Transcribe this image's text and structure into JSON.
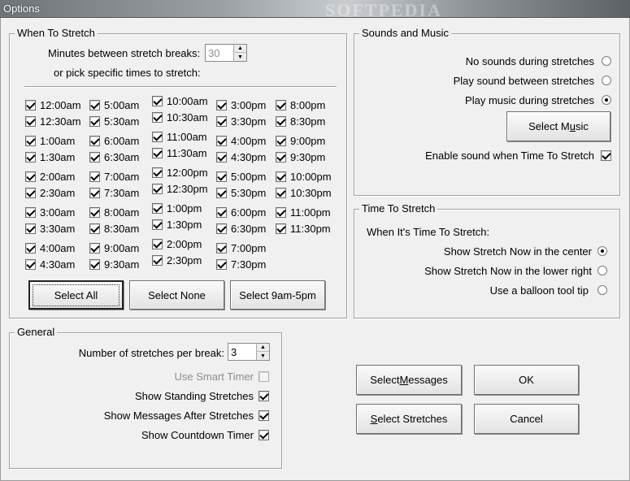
{
  "window": {
    "title": "Options",
    "watermark": "SOFTPEDIA"
  },
  "stretch": {
    "legend": "When To Stretch",
    "minutes_label": "Minutes between stretch breaks:",
    "minutes_value": "30",
    "pick_label": "or pick specific times to stretch:",
    "times": [
      [
        "12:00am",
        "5:00am",
        "10:00am",
        "3:00pm",
        "8:00pm"
      ],
      [
        "12:30am",
        "5:30am",
        "10:30am",
        "3:30pm",
        "8:30pm"
      ],
      [
        "1:00am",
        "6:00am",
        "11:00am",
        "4:00pm",
        "9:00pm"
      ],
      [
        "1:30am",
        "6:30am",
        "11:30am",
        "4:30pm",
        "9:30pm"
      ],
      [
        "2:00am",
        "7:00am",
        "12:00pm",
        "5:00pm",
        "10:00pm"
      ],
      [
        "2:30am",
        "7:30am",
        "12:30pm",
        "5:30pm",
        "10:30pm"
      ],
      [
        "3:00am",
        "8:00am",
        "1:00pm",
        "6:00pm",
        "11:00pm"
      ],
      [
        "3:30am",
        "8:30am",
        "1:30pm",
        "6:30pm",
        "11:30pm"
      ],
      [
        "4:00am",
        "9:00am",
        "2:00pm",
        "7:00pm",
        ""
      ],
      [
        "4:30am",
        "9:30am",
        "2:30pm",
        "7:30pm",
        ""
      ]
    ],
    "select_all": "Select All",
    "select_none": "Select None",
    "select_9to5": "Select 9am-5pm"
  },
  "sound": {
    "legend": "Sounds and Music",
    "opt_none": "No sounds during stretches",
    "opt_between": "Play sound between stretches",
    "opt_music": "Play music during stretches",
    "select_music_pre": "Select M",
    "select_music_key": "u",
    "select_music_post": "sic",
    "enable_label": "Enable sound when Time To Stretch"
  },
  "tts": {
    "legend": "Time To Stretch",
    "heading": "When It's Time To Stretch:",
    "opt_center": "Show Stretch Now in the center",
    "opt_lower": "Show Stretch Now in the lower right",
    "opt_balloon": "Use a balloon tool tip"
  },
  "general": {
    "legend": "General",
    "count_label": "Number of stretches per break:",
    "count_value": "3",
    "smart_timer": "Use Smart Timer",
    "standing": "Show Standing Stretches",
    "messages": "Show Messages After Stretches",
    "countdown": "Show Countdown Timer"
  },
  "buttons": {
    "select_messages_pre": "Select ",
    "select_messages_key": "M",
    "select_messages_post": "essages",
    "select_stretches_key": "S",
    "select_stretches_post": "elect Stretches",
    "ok": "OK",
    "cancel": "Cancel"
  }
}
